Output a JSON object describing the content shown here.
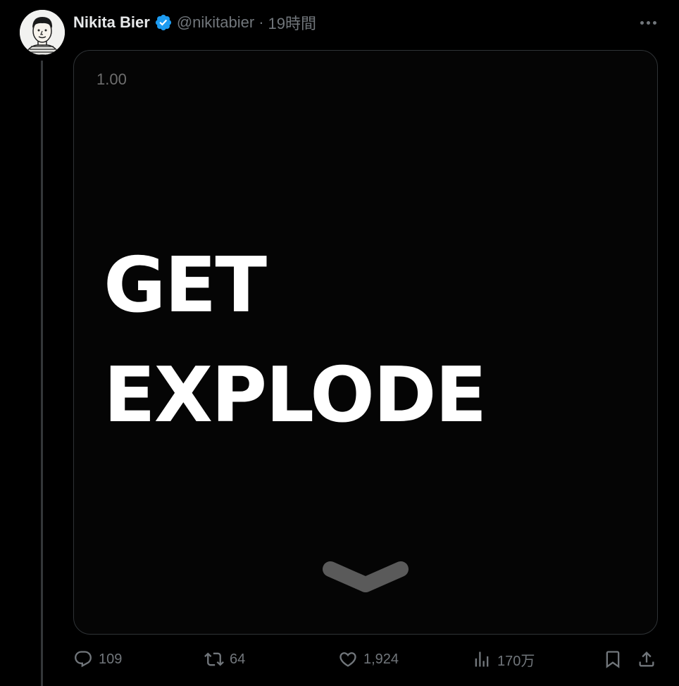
{
  "author": {
    "name": "Nikita Bier",
    "verified": true,
    "handle": "@nikitabier",
    "separator": "·",
    "time": "19時間"
  },
  "menu": {
    "icon": "more-horizontal-icon"
  },
  "media": {
    "playback_speed": "1.00",
    "text_line_1": "GET",
    "text_line_2": "EXPLODE",
    "chevron_icon": "chevron-down-icon"
  },
  "stats": {
    "replies": "109",
    "reposts": "64",
    "likes": "1,924",
    "views": "170万"
  },
  "colors": {
    "background": "#000000",
    "text_primary": "#e7e9ea",
    "text_secondary": "#71767b",
    "verified_blue": "#1d9bf0",
    "border": "#2f3336"
  }
}
